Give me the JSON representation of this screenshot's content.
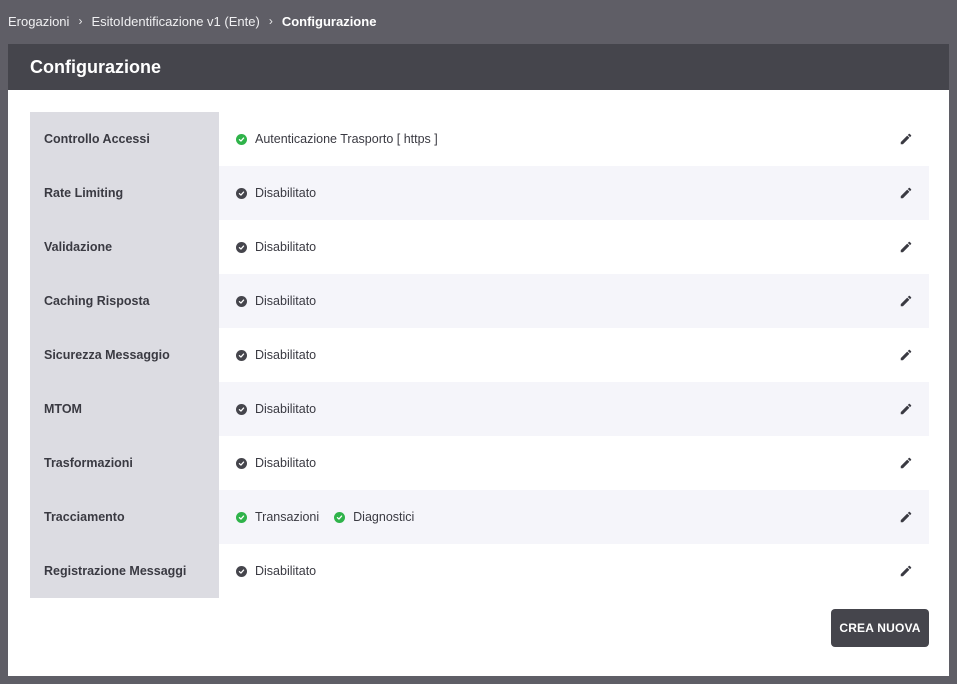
{
  "breadcrumb": {
    "items": [
      "Erogazioni",
      "EsitoIdentificazione v1 (Ente)",
      "Configurazione"
    ]
  },
  "panel": {
    "title": "Configurazione"
  },
  "colors": {
    "enabled": "#2fb34a",
    "disabled": "#45454c",
    "header_bg": "#45454c",
    "label_bg": "#dcdce2"
  },
  "rows": [
    {
      "label": "Controllo Accessi",
      "statuses": [
        {
          "text": "Autenticazione Trasporto [ https ]",
          "state": "enabled",
          "icon": "check-circle-icon"
        }
      ]
    },
    {
      "label": "Rate Limiting",
      "statuses": [
        {
          "text": "Disabilitato",
          "state": "disabled",
          "icon": "check-circle-icon"
        }
      ]
    },
    {
      "label": "Validazione",
      "statuses": [
        {
          "text": "Disabilitato",
          "state": "disabled",
          "icon": "check-circle-icon"
        }
      ]
    },
    {
      "label": "Caching Risposta",
      "statuses": [
        {
          "text": "Disabilitato",
          "state": "disabled",
          "icon": "check-circle-icon"
        }
      ]
    },
    {
      "label": "Sicurezza Messaggio",
      "statuses": [
        {
          "text": "Disabilitato",
          "state": "disabled",
          "icon": "check-circle-icon"
        }
      ]
    },
    {
      "label": "MTOM",
      "statuses": [
        {
          "text": "Disabilitato",
          "state": "disabled",
          "icon": "check-circle-icon"
        }
      ]
    },
    {
      "label": "Trasformazioni",
      "statuses": [
        {
          "text": "Disabilitato",
          "state": "disabled",
          "icon": "check-circle-icon"
        }
      ]
    },
    {
      "label": "Tracciamento",
      "statuses": [
        {
          "text": "Transazioni",
          "state": "enabled",
          "icon": "check-circle-icon"
        },
        {
          "text": "Diagnostici",
          "state": "enabled",
          "icon": "check-circle-icon"
        }
      ]
    },
    {
      "label": "Registrazione Messaggi",
      "statuses": [
        {
          "text": "Disabilitato",
          "state": "disabled",
          "icon": "check-circle-icon"
        }
      ]
    }
  ],
  "actions": {
    "edit_icon": "pencil-icon",
    "create_label": "CREA NUOVA"
  }
}
